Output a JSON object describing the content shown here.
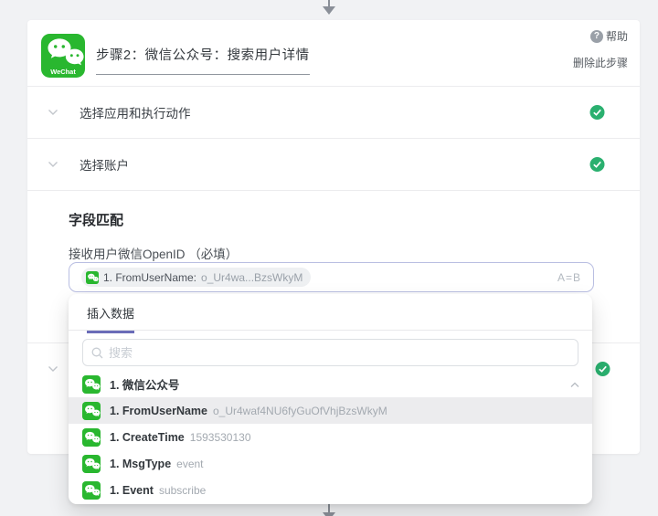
{
  "page": {
    "step_title": "步骤2：微信公众号：搜索用户详情",
    "help_label": "帮助",
    "help_glyph": "?",
    "delete_label": "删除此步骤"
  },
  "sections": [
    {
      "label": "选择应用和执行动作",
      "status": "complete"
    },
    {
      "label": "选择账户",
      "status": "complete"
    }
  ],
  "field_match": {
    "title": "字段匹配",
    "field_label": "接收用户微信OpenID （必填）",
    "tag": {
      "name": "1. FromUserName:",
      "value": "o_Ur4wa...BzsWkyM"
    },
    "mapper_hint": "A=B"
  },
  "dropdown": {
    "tab": "插入数据",
    "search_placeholder": "搜索",
    "group": {
      "label": "1. 微信公众号"
    },
    "items": [
      {
        "name": "1. FromUserName",
        "value": "o_Ur4waf4NU6fyGuOfVhjBzsWkyM",
        "highlighted": true
      },
      {
        "name": "1. CreateTime",
        "value": "1593530130"
      },
      {
        "name": "1. MsgType",
        "value": "event"
      },
      {
        "name": "1. Event",
        "value": "subscribe"
      }
    ]
  },
  "colors": {
    "accent_purple": "#6a6cb8",
    "success_green": "#2ab06f",
    "wechat_green": "#29b72f",
    "highlight_row": "#ececee",
    "input_focus_border": "#b9bee2",
    "page_background": "#f1f2f4"
  }
}
